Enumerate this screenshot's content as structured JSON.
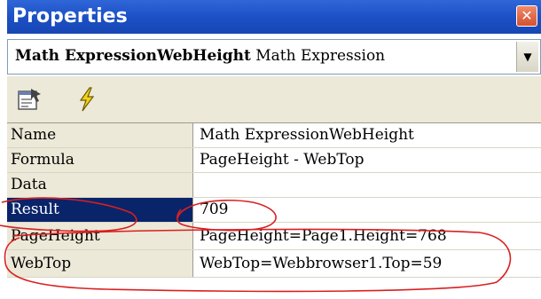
{
  "window": {
    "title": "Properties",
    "close_glyph": "✕"
  },
  "object_selector": {
    "name": "Math ExpressionWebHeight",
    "type": "Math Expression",
    "dropdown_glyph": "▼"
  },
  "toolbar": {
    "icons": [
      "property-pages-icon",
      "events-lightning-icon"
    ]
  },
  "properties": [
    {
      "name": "Name",
      "value": "Math ExpressionWebHeight"
    },
    {
      "name": "Formula",
      "value": "PageHeight - WebTop"
    },
    {
      "name": "Data",
      "value": ""
    },
    {
      "name": "Result",
      "value": "709"
    },
    {
      "name": "PageHeight",
      "value": "PageHeight=Page1.Height=768"
    },
    {
      "name": "WebTop",
      "value": "WebTop=Webbrowser1.Top=59"
    }
  ],
  "colors": {
    "title_bar": "#1b4fc4",
    "selected_row": "#0a246a",
    "annotation": "#d92020",
    "toolbar": "#ece9d8"
  }
}
